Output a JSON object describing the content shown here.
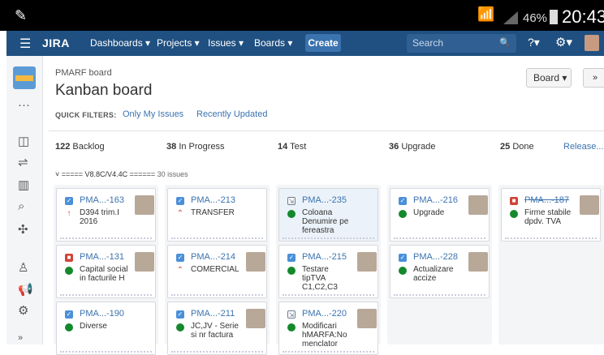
{
  "statusbar": {
    "battery": "46%",
    "time": "20:43"
  },
  "topbar": {
    "logo": "JIRA",
    "nav": [
      "Dashboards ▾",
      "Projects ▾",
      "Issues ▾",
      "Boards ▾"
    ],
    "create": "Create",
    "search_placeholder": "Search",
    "help": "?▾",
    "gear": "⚙▾"
  },
  "board": {
    "project": "PMARF board",
    "title": "Kanban board",
    "quick_filters_label": "QUICK FILTERS:",
    "quick_filters": [
      "Only My Issues",
      "Recently Updated"
    ],
    "board_menu": "Board ▾",
    "collapse": "»"
  },
  "columns": [
    {
      "count": "122",
      "name": "Backlog"
    },
    {
      "count": "38",
      "name": "In Progress"
    },
    {
      "count": "14",
      "name": "Test"
    },
    {
      "count": "36",
      "name": "Upgrade"
    },
    {
      "count": "25",
      "name": "Done"
    }
  ],
  "release_link": "Release...",
  "swimlane": {
    "name": "===== V8.8C/V4.4C ======",
    "count": "30 issues"
  },
  "cards": [
    {
      "col": 0,
      "row": 0,
      "key": "PMA...-163",
      "type": "task",
      "priority": "red",
      "summary": "D394 trim.I 2016",
      "avatar": true
    },
    {
      "col": 0,
      "row": 1,
      "key": "PMA...-131",
      "type": "bug",
      "priority": "green",
      "summary": "Capital social in facturile H",
      "avatar": true
    },
    {
      "col": 0,
      "row": 2,
      "key": "PMA...-190",
      "type": "task",
      "priority": "green",
      "summary": "Diverse",
      "avatar": false
    },
    {
      "col": 1,
      "row": 0,
      "key": "PMA...-213",
      "type": "task",
      "priority": "red",
      "summary": "TRANSFER",
      "avatar": false
    },
    {
      "col": 1,
      "row": 1,
      "key": "PMA...-214",
      "type": "task",
      "priority": "red",
      "summary": "COMERCIAL",
      "avatar": true
    },
    {
      "col": 1,
      "row": 2,
      "key": "PMA...-211",
      "type": "task",
      "priority": "green",
      "summary": "JC,JV - Serie si nr factura",
      "avatar": true
    },
    {
      "col": 2,
      "row": 0,
      "key": "PMA...-235",
      "type": "sub",
      "priority": "green",
      "summary": "Coloana Denumire pe fereastra",
      "avatar": false,
      "selected": true
    },
    {
      "col": 2,
      "row": 1,
      "key": "PMA...-215",
      "type": "task",
      "priority": "green",
      "summary": "Testare tipTVA C1,C2,C3",
      "avatar": true
    },
    {
      "col": 2,
      "row": 2,
      "key": "PMA...-220",
      "type": "sub",
      "priority": "green",
      "summary": "Modificari hMARFA:No menclator",
      "avatar": true
    },
    {
      "col": 3,
      "row": 0,
      "key": "PMA...-216",
      "type": "task",
      "priority": "green",
      "summary": "Upgrade",
      "avatar": true
    },
    {
      "col": 3,
      "row": 1,
      "key": "PMA...-228",
      "type": "task",
      "priority": "green",
      "summary": "Actualizare accize",
      "avatar": true
    },
    {
      "col": 4,
      "row": 0,
      "key": "PMA...-187",
      "type": "bug",
      "priority": "green",
      "summary": "Firme stabile dpdv. TVA",
      "avatar": true,
      "done": true
    }
  ]
}
